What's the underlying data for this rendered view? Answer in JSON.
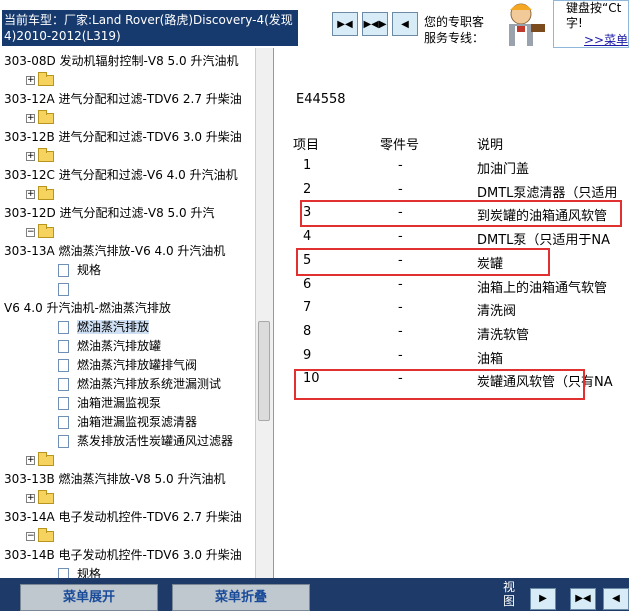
{
  "header": {
    "vehicle_text": "当前车型：厂家:Land Rover(路虎)Discovery-4(发现4)2010-2012(L319)",
    "nav_buttons": [
      "▶◀",
      "▶◀▶",
      "◀"
    ],
    "hotline_line1": "您的专职客",
    "hotline_line2": "服务专线：",
    "tip_line1": "键盘按“Ct",
    "tip_line2": "字!",
    "tip_link": ">>菜单"
  },
  "tree": {
    "rows": [
      {
        "type": "node",
        "label": "303-08D 发动机辐射控制-V8 5.0 升汽油机"
      },
      {
        "type": "folder"
      },
      {
        "type": "node",
        "label": "303-12A 进气分配和过滤-TDV6 2.7 升柴油"
      },
      {
        "type": "folder"
      },
      {
        "type": "node",
        "label": "303-12B 进气分配和过滤-TDV6 3.0 升柴油"
      },
      {
        "type": "folder"
      },
      {
        "type": "node",
        "label": "303-12C 进气分配和过滤-V6 4.0 升汽油机"
      },
      {
        "type": "folder"
      },
      {
        "type": "node",
        "label": "303-12D 进气分配和过滤-V8 5.0 升汽"
      },
      {
        "type": "folder-open"
      },
      {
        "type": "node",
        "label": "303-13A 燃油蒸汽排放-V6 4.0 升汽油机"
      },
      {
        "type": "doc",
        "label": "规格"
      },
      {
        "type": "doc",
        "label": ""
      },
      {
        "type": "node",
        "label": "V6 4.0 升汽油机-燃油蒸汽排放"
      },
      {
        "type": "doc",
        "label": "燃油蒸汽排放",
        "selected": true
      },
      {
        "type": "doc",
        "label": "燃油蒸汽排放罐"
      },
      {
        "type": "doc",
        "label": "燃油蒸汽排放罐排气阀"
      },
      {
        "type": "doc",
        "label": "燃油蒸汽排放系统泄漏测试"
      },
      {
        "type": "doc",
        "label": "油箱泄漏监视泵"
      },
      {
        "type": "doc",
        "label": "油箱泄漏监视泵滤清器"
      },
      {
        "type": "doc",
        "label": "蒸发排放活性炭罐通风过滤器"
      },
      {
        "type": "folder"
      },
      {
        "type": "node",
        "label": "303-13B 燃油蒸汽排放-V8 5.0 升汽油机"
      },
      {
        "type": "folder"
      },
      {
        "type": "node",
        "label": "303-14A 电子发动机控件-TDV6 2.7 升柴油"
      },
      {
        "type": "folder-open"
      },
      {
        "type": "node",
        "label": "303-14B 电子发动机控件-TDV6 3.0 升柴油"
      },
      {
        "type": "doc",
        "label": "规格"
      }
    ]
  },
  "content": {
    "code": "E44558",
    "headers": [
      "项目",
      "零件号",
      "说明"
    ],
    "rows": [
      {
        "item": "1",
        "part": "-",
        "desc": "加油门盖"
      },
      {
        "item": "2",
        "part": "-",
        "desc": "DMTL泵滤清器（只适用"
      },
      {
        "item": "3",
        "part": "-",
        "desc": "到炭罐的油箱通风软管"
      },
      {
        "item": "4",
        "part": "-",
        "desc": "DMTL泵（只适用于NA"
      },
      {
        "item": "5",
        "part": "-",
        "desc": "炭罐"
      },
      {
        "item": "6",
        "part": "-",
        "desc": "油箱上的油箱通气软管"
      },
      {
        "item": "7",
        "part": "-",
        "desc": "清洗阀"
      },
      {
        "item": "8",
        "part": "-",
        "desc": "清洗软管"
      },
      {
        "item": "9",
        "part": "-",
        "desc": "油箱"
      },
      {
        "item": "10",
        "part": "-",
        "desc": "炭罐通风软管（只有NA"
      }
    ],
    "highlight_color": "#e03030"
  },
  "bottom": {
    "expand_label": "菜单展开",
    "collapse_label": "菜单折叠",
    "view_label": "视图",
    "view_buttons": [
      "▶",
      "▶◀",
      "◀"
    ]
  }
}
